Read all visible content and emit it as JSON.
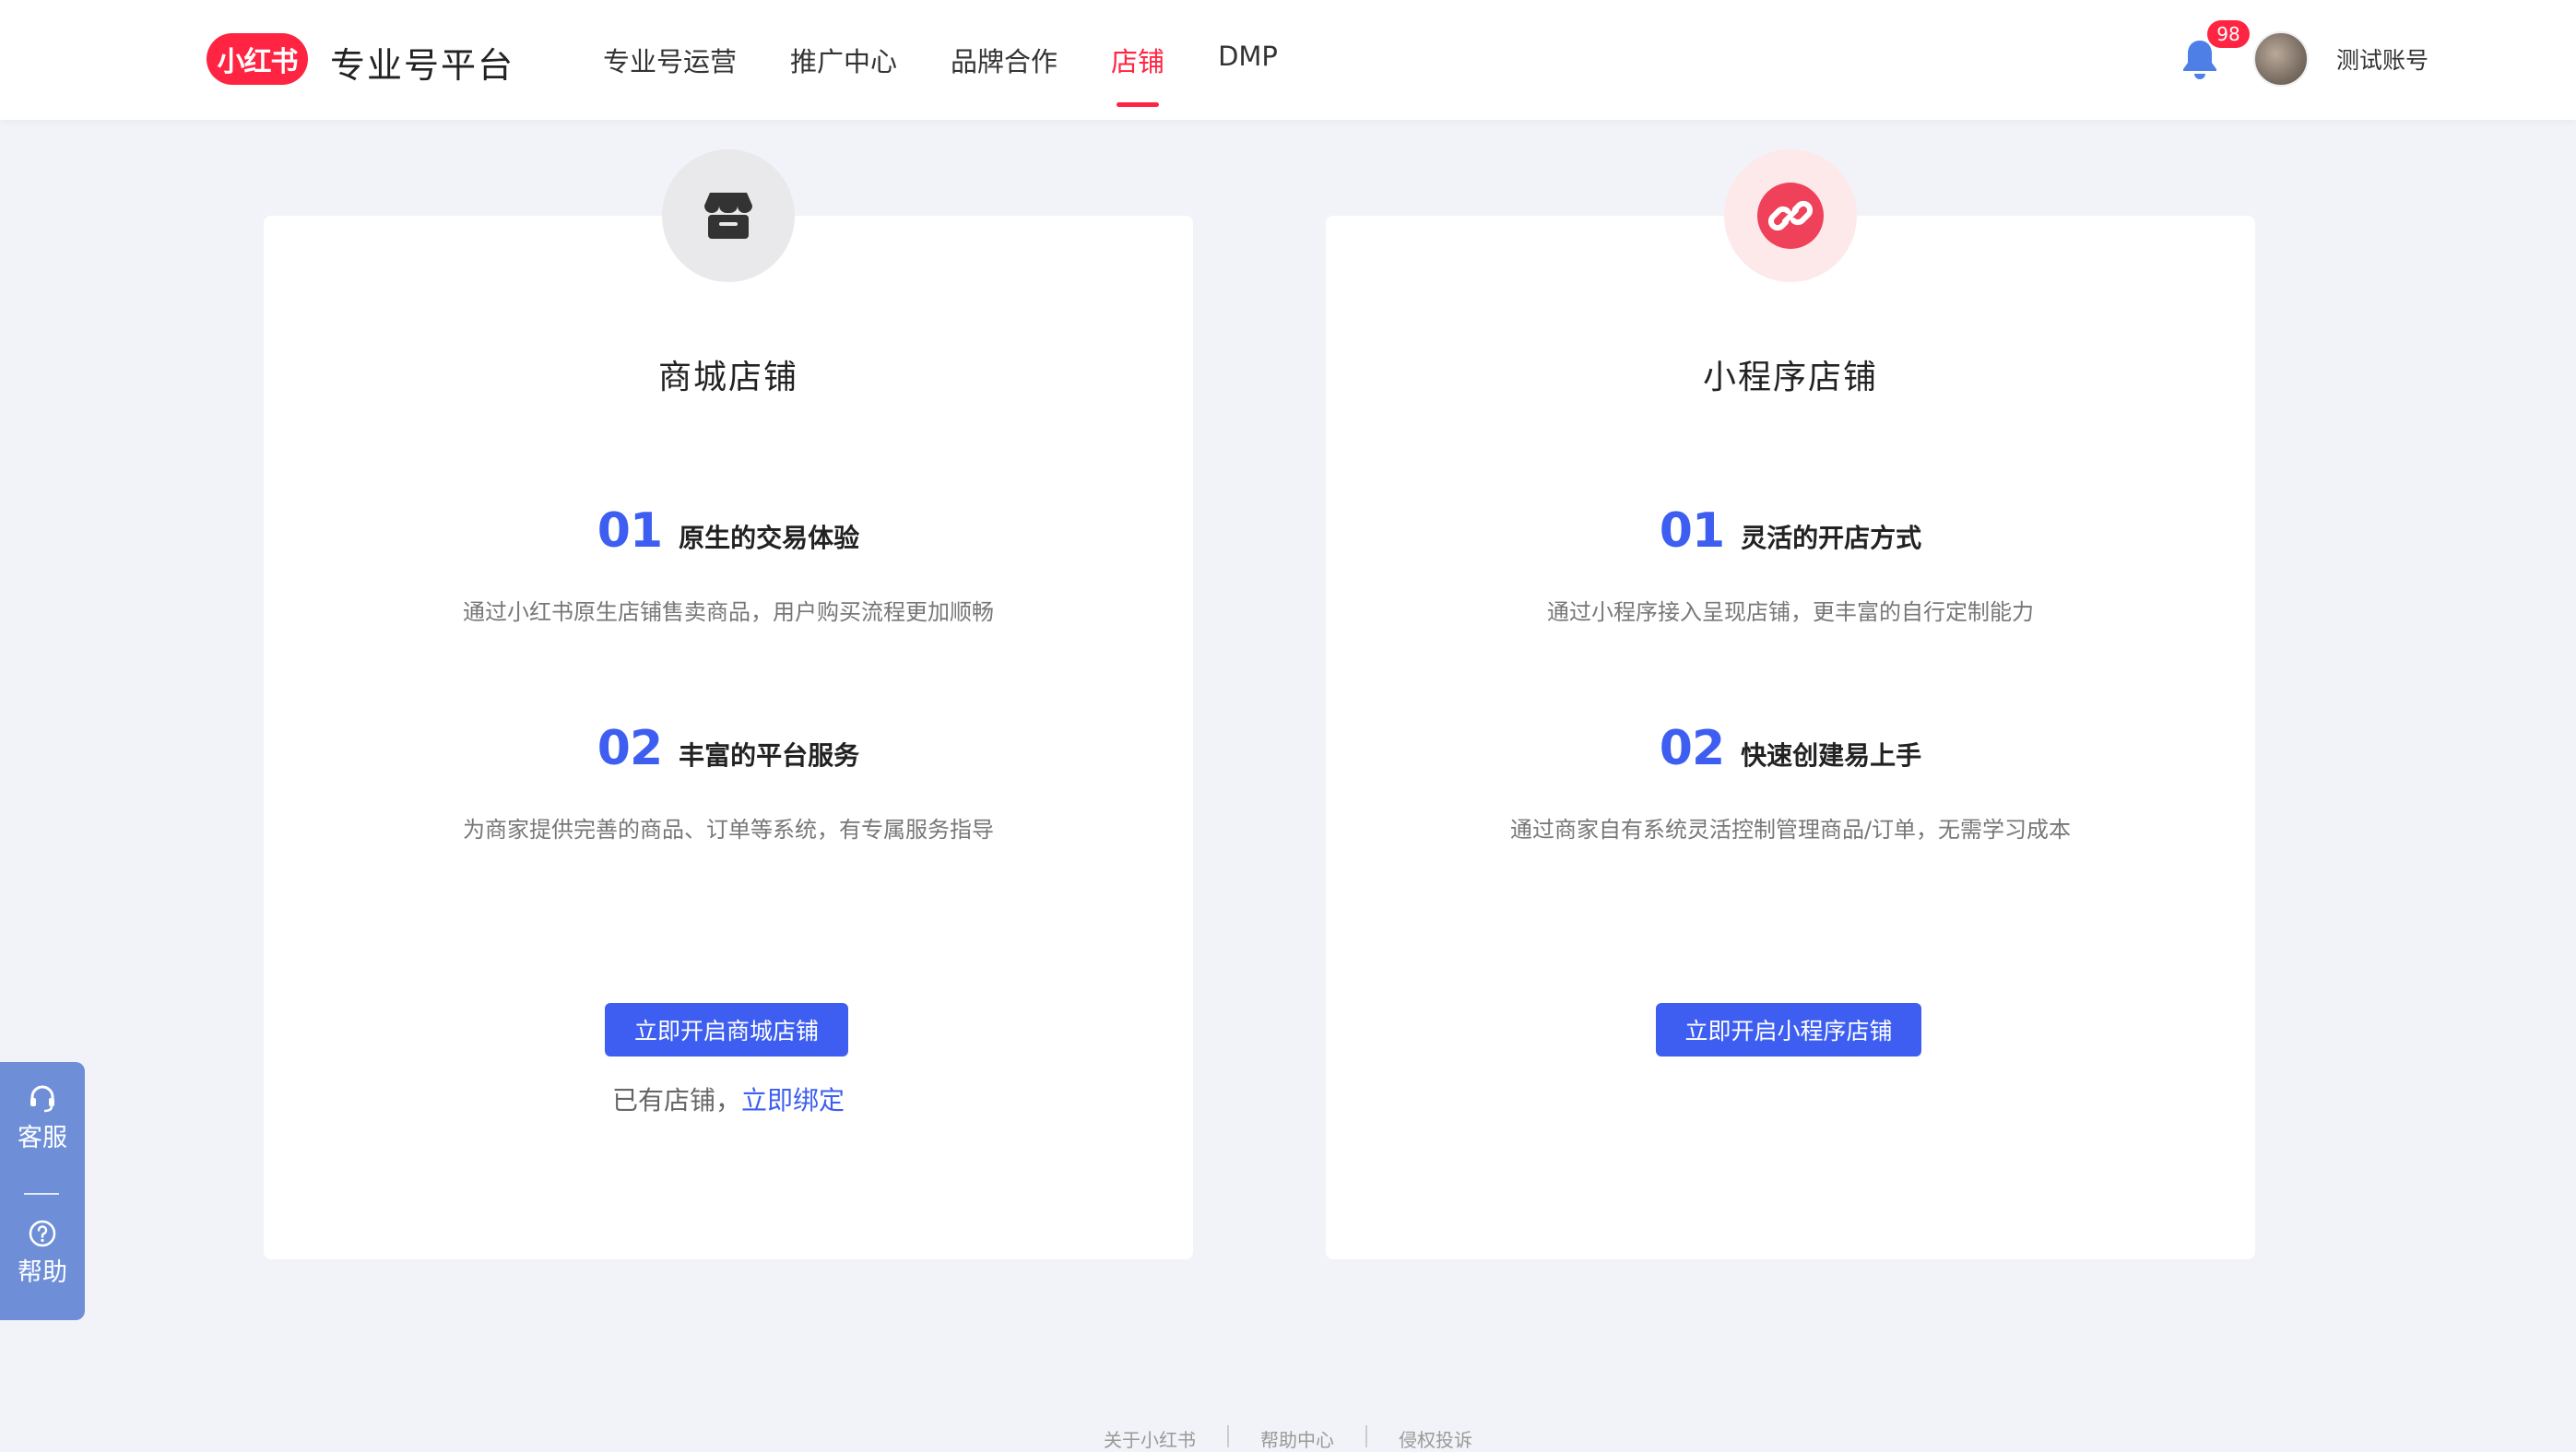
{
  "header": {
    "logo_text": "小红书",
    "platform_title": "专业号平台",
    "nav": [
      {
        "label": "专业号运营"
      },
      {
        "label": "推广中心"
      },
      {
        "label": "品牌合作"
      },
      {
        "label": "店铺",
        "active": true
      },
      {
        "label": "DMP"
      }
    ],
    "notification_count": "98",
    "account_name": "测试账号",
    "accent_color": "#ff2442"
  },
  "cards": [
    {
      "icon": "storefront-icon",
      "title": "商城店铺",
      "features": [
        {
          "num": "01",
          "title": "原生的交易体验",
          "desc": "通过小红书原生店铺售卖商品，用户购买流程更加顺畅"
        },
        {
          "num": "02",
          "title": "丰富的平台服务",
          "desc": "为商家提供完善的商品、订单等系统，有专属服务指导"
        }
      ],
      "button_label": "立即开启商城店铺",
      "bind_prefix": "已有店铺，",
      "bind_link": "立即绑定"
    },
    {
      "icon": "link-icon",
      "title": "小程序店铺",
      "features": [
        {
          "num": "01",
          "title": "灵活的开店方式",
          "desc": "通过小程序接入呈现店铺，更丰富的自行定制能力"
        },
        {
          "num": "02",
          "title": "快速创建易上手",
          "desc": "通过商家自有系统灵活控制管理商品/订单，无需学习成本"
        }
      ],
      "button_label": "立即开启小程序店铺"
    }
  ],
  "float_panel": {
    "service_label": "客服",
    "help_label": "帮助"
  },
  "footer": {
    "links": [
      "关于小红书",
      "帮助中心",
      "侵权投诉"
    ]
  },
  "colors": {
    "primary_blue": "#3d5ef0",
    "brand_red": "#ff2442"
  }
}
